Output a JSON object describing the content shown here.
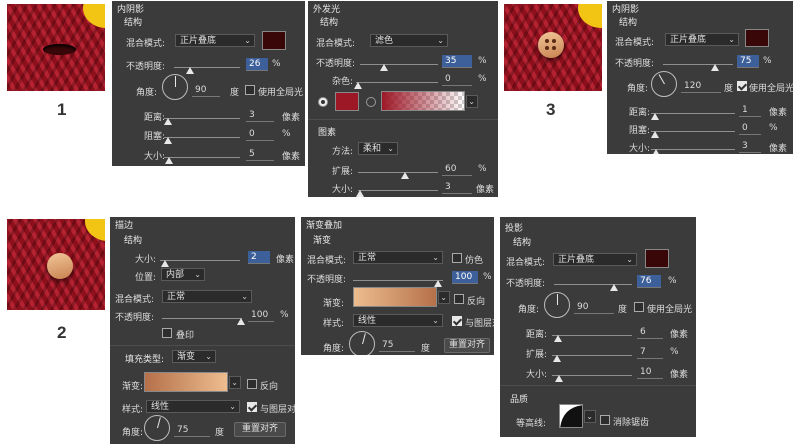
{
  "steps": {
    "one": "1",
    "two": "2",
    "three": "3"
  },
  "colors": {
    "dark_red": "#3a0709",
    "crimson": "#9d1827",
    "gradient_light": "#edbd8f",
    "gradient_dark": "#b5704a"
  },
  "inner_shadow1": {
    "title": "内阴影",
    "section": "结构",
    "blend_label": "混合模式:",
    "blend_value": "正片叠底",
    "opacity_label": "不透明度:",
    "opacity_value": "26",
    "pct": "%",
    "angle_label": "角度:",
    "angle_value": "90",
    "degree": "度",
    "global_light": "使用全局光",
    "distance_label": "距离:",
    "distance_value": "3",
    "choke_label": "阻塞:",
    "choke_value": "0",
    "size_label": "大小:",
    "size_value": "5",
    "px": "像素"
  },
  "outer_glow": {
    "title": "外发光",
    "section": "结构",
    "blend_label": "混合模式:",
    "blend_value": "滤色",
    "opacity_label": "不透明度:",
    "opacity_value": "35",
    "pct": "%",
    "noise_label": "杂色:",
    "noise_value": "0",
    "elements_title": "图素",
    "method_label": "方法:",
    "method_value": "柔和",
    "spread_label": "扩展:",
    "spread_value": "60",
    "size_label": "大小:",
    "size_value": "3",
    "px": "像素"
  },
  "inner_shadow3": {
    "title": "内阴影",
    "section": "结构",
    "blend_label": "混合模式:",
    "blend_value": "正片叠底",
    "opacity_label": "不透明度:",
    "opacity_value": "75",
    "pct": "%",
    "angle_label": "角度:",
    "angle_value": "120",
    "degree": "度",
    "global_light": "使用全局光",
    "distance_label": "距离:",
    "distance_value": "1",
    "choke_label": "阻塞:",
    "choke_value": "0",
    "size_label": "大小:",
    "size_value": "3",
    "px": "像素"
  },
  "stroke": {
    "title": "描边",
    "section": "结构",
    "size_label": "大小:",
    "size_value": "2",
    "px": "像素",
    "position_label": "位置:",
    "position_value": "内部",
    "blend_label": "混合模式:",
    "blend_value": "正常",
    "opacity_label": "不透明度:",
    "opacity_value": "100",
    "pct": "%",
    "overprint": "叠印",
    "fill_type_label": "填充类型:",
    "fill_type_value": "渐变",
    "gradient_label": "渐变:",
    "reverse": "反向",
    "style_label": "样式:",
    "style_value": "线性",
    "align_layer": "与图层对",
    "angle_label": "角度:",
    "angle_value": "75",
    "degree": "度",
    "reset_align": "重置对齐"
  },
  "gradient_overlay": {
    "title": "渐变叠加",
    "section": "渐变",
    "blend_label": "混合模式:",
    "blend_value": "正常",
    "dither": "仿色",
    "opacity_label": "不透明度:",
    "opacity_value": "100",
    "pct": "%",
    "gradient_label": "渐变:",
    "reverse": "反向",
    "style_label": "样式:",
    "style_value": "线性",
    "align_layer": "与图层对",
    "angle_label": "角度:",
    "angle_value": "75",
    "degree": "度",
    "reset_align": "重置对齐"
  },
  "drop_shadow": {
    "title": "投影",
    "section": "结构",
    "blend_label": "混合模式:",
    "blend_value": "正片叠底",
    "opacity_label": "不透明度:",
    "opacity_value": "76",
    "pct": "%",
    "angle_label": "角度:",
    "angle_value": "90",
    "degree": "度",
    "global_light": "使用全局光",
    "distance_label": "距离:",
    "distance_value": "6",
    "px": "像素",
    "spread_label": "扩展:",
    "spread_value": "7",
    "size_label": "大小:",
    "size_value": "10",
    "quality_title": "品质",
    "contour_label": "等高线:",
    "antialias": "消除锯齿"
  }
}
